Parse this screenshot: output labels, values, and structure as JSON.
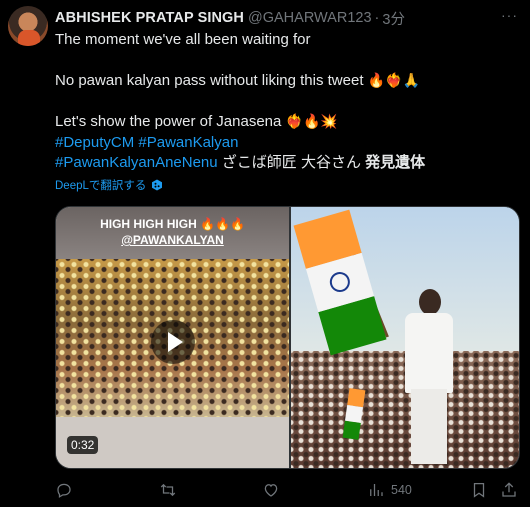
{
  "tweet": {
    "author_name": "ABHISHEK PRATAP SINGH",
    "author_handle": "@GAHARWAR123",
    "separator": "·",
    "time": "3分",
    "lines": {
      "l1": "The moment we've all been waiting for",
      "l3_text": "No pawan kalyan pass without liking this tweet ",
      "l3_emoji": "🔥❤️‍🔥🙏",
      "l5_text": "Let's show the power of Janasena ",
      "l5_emoji": "❤️‍🔥🔥💥",
      "hashtag1": "#DeputyCM",
      "hashtag2": "#PawanKalyan",
      "hashtag3": "#PawanKalyanAneNenu",
      "l7_plain": " ざこば師匠 大谷さん ",
      "l7_bold": "発見遺体"
    },
    "translate_label": "DeepLで翻訳する"
  },
  "media": {
    "video_caption_line1": "HIGH HIGH HIGH 🔥🔥🔥",
    "video_caption_line2": "@PAWANKALYAN",
    "video_duration": "0:32"
  },
  "actions": {
    "reply_icon": "reply-icon",
    "retweet_icon": "retweet-icon",
    "like_icon": "heart-icon",
    "views_icon": "views-icon",
    "views_count": "540",
    "bookmark_icon": "bookmark-icon",
    "share_icon": "share-icon"
  },
  "colors": {
    "background": "#000000",
    "text": "#e7e9ea",
    "muted": "#71767b",
    "link": "#1d9bf0"
  }
}
